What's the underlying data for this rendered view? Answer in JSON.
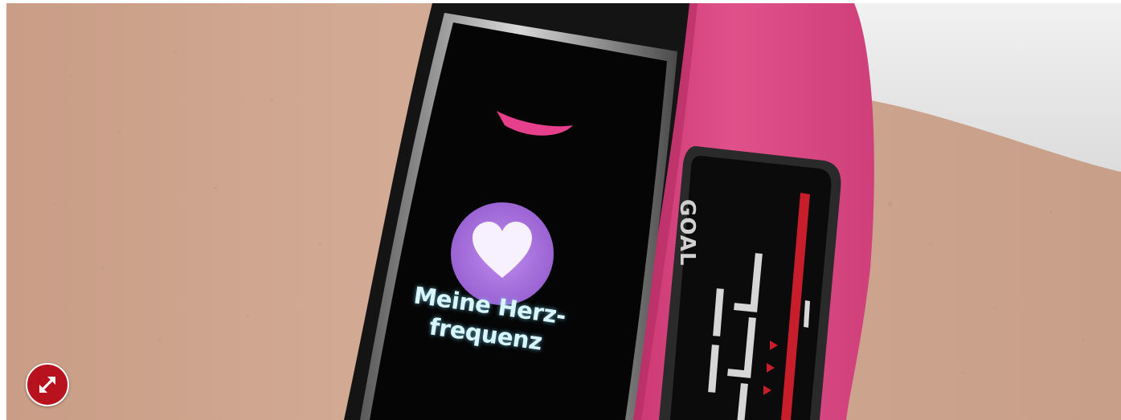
{
  "photo": {
    "screen_text_lines": [
      "Meine Herz-",
      "frequenz"
    ],
    "second_tracker_label": "GOAL"
  },
  "controls": {
    "expand_icon": "expand-arrows-icon"
  },
  "colors": {
    "band_pink": "#d9457f",
    "band_black": "#151515",
    "heart_circle": "#b07ae0",
    "expand_button": "#b8121e",
    "skin": "#cfa68f"
  }
}
